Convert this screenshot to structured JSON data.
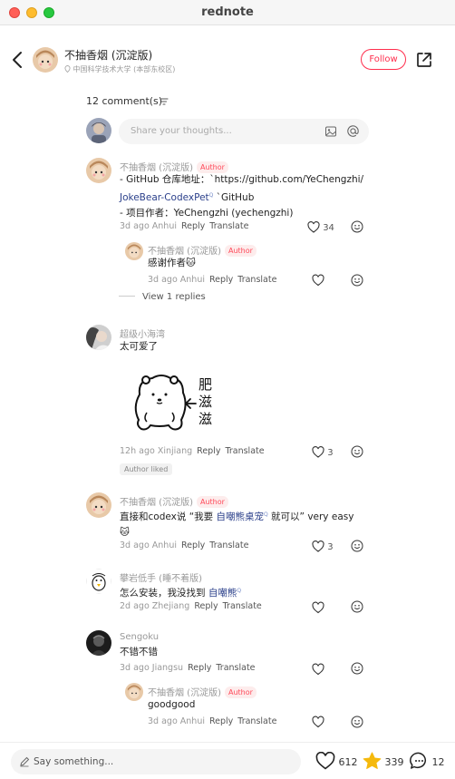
{
  "window": {
    "title": "rednote"
  },
  "header": {
    "author_name": "不抽香烟 (沉淀版)",
    "location": "中国科学技术大学 (本部东校区)",
    "follow_label": "Follow"
  },
  "comments_header": {
    "count_label": "12 comment(s)"
  },
  "composer": {
    "placeholder": "Share your thoughts..."
  },
  "labels": {
    "author_badge": "Author",
    "reply": "Reply",
    "translate": "Translate",
    "author_liked": "Author liked"
  },
  "comments": [
    {
      "name": "不抽香烟 (沉淀版)",
      "text_line1": "- GitHub 仓库地址：`https://github.com/YeChengzhi/",
      "text_line2_link": "JokeBear-CodexPet",
      "text_line2_rest": " `GitHub",
      "text_line3": "- 项目作者：YeChengzhi (yechengzhi)",
      "meta": "3d ago Anhui",
      "likes": "34",
      "reply": {
        "name": "不抽香烟 (沉淀版)",
        "text": "感谢作者🐱",
        "meta": "3d ago Anhui"
      },
      "view_replies": "View 1 replies"
    },
    {
      "name": "超级小海湾",
      "text": "太可爱了",
      "sticker_text": "肥滋滋",
      "meta": "12h ago Xinjiang",
      "likes": "3"
    },
    {
      "name": "不抽香烟 (沉淀版)",
      "text_pre": "直接和codex说 “我要 ",
      "text_link": "自嘲熊桌宠",
      "text_post": " 就可以” very easy",
      "text_line2": "🐱",
      "meta": "3d ago Anhui",
      "likes": "3"
    },
    {
      "name": "攀岩低手 (睡不着版)",
      "text_pre": "怎么安装，我没找到 ",
      "text_link": "自嘲熊",
      "meta": "2d ago Zhejiang"
    },
    {
      "name": "Sengoku",
      "text": "不错不错",
      "meta": "3d ago Jiangsu",
      "reply": {
        "name": "不抽香烟 (沉淀版)",
        "text": "goodgood",
        "meta": "3d ago Anhui"
      }
    }
  ],
  "bottom": {
    "placeholder": "Say something...",
    "likes": "612",
    "stars": "339",
    "comments": "12"
  },
  "colors": {
    "accent": "#ff2e4d",
    "link": "#2a3f8a",
    "star": "#f5b90d"
  },
  "icons": [
    "back-icon",
    "share-icon",
    "sort-icon",
    "image-icon",
    "at-icon",
    "heart-icon",
    "emoji-icon",
    "pen-icon",
    "star-icon",
    "comment-bubble-icon",
    "location-icon"
  ]
}
